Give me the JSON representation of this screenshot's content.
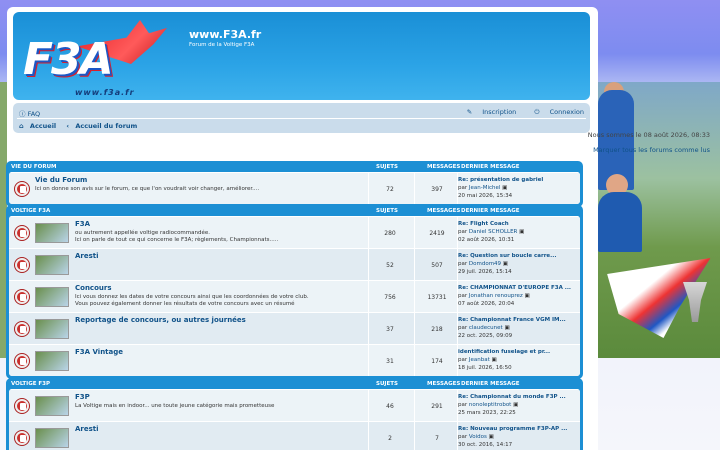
{
  "header": {
    "site_title": "www.F3A.fr",
    "site_desc": "Forum de la Voltige F3A",
    "logo_text": "F3A",
    "logo_url": "www.f3a.fr"
  },
  "nav": {
    "faq": "FAQ",
    "register": "Inscription",
    "login": "Connexion",
    "home": "Accueil",
    "forum_index": "Accueil du forum",
    "sep": "‹"
  },
  "info": {
    "date": "Nous sommes le 08 août 2026, 08:33",
    "mark_read": "Marquer tous les forums comme lus"
  },
  "columns": {
    "topics": "SUJETS",
    "posts": "MESSAGES",
    "last_post": "DERNIER MESSAGE"
  },
  "categories": [
    {
      "title": "VIE DU FORUM",
      "forums": [
        {
          "name": "Vie du Forum",
          "desc": "Ici on donne son avis sur le forum, ce que l'on voudrait voir changer, améliorer....",
          "topics": "72",
          "posts": "397",
          "last_title": "Re: présentation de gabriel",
          "last_by": "Jean-Michel",
          "last_date": "20 mai 2026, 15:34"
        }
      ]
    },
    {
      "title": "VOLTIGE F3A",
      "forums": [
        {
          "name": "F3A",
          "desc": "ou autrement appellée voltige radiocommandée.\nIci on parle de tout ce qui concerne le F3A; règlements, Championnats.....",
          "topics": "280",
          "posts": "2419",
          "last_title": "Re: Flight Coach",
          "last_by": "Daniel SCHOLLER",
          "last_date": "02 août 2026, 10:31"
        },
        {
          "name": "Aresti",
          "desc": "",
          "topics": "52",
          "posts": "507",
          "last_title": "Re: Question sur boucle carre...",
          "last_by": "Domdom49",
          "last_date": "29 juil. 2026, 15:14"
        },
        {
          "name": "Concours",
          "desc": "Ici vous donnez les dates de votre concours ainsi que les coordonnées de votre club.\nVous pouvez également donner les résultats de votre concours avec un résumé",
          "topics": "756",
          "posts": "13731",
          "last_title": "Re: CHAMPIONNAT D'EUROPE F3A ...",
          "last_by": "Jonathan renouprez",
          "last_date": "07 août 2026, 20:04"
        },
        {
          "name": "Reportage de concours, ou autres journées",
          "desc": "",
          "topics": "37",
          "posts": "218",
          "last_title": "Re: Championnat France VGM IM...",
          "last_by": "claudecunet",
          "last_date": "22 oct. 2025, 09:09"
        },
        {
          "name": "F3A Vintage",
          "desc": "",
          "topics": "31",
          "posts": "174",
          "last_title": "identification fuselage et pr...",
          "last_by": "Jeanbat",
          "last_date": "18 juil. 2026, 16:50"
        }
      ]
    },
    {
      "title": "VOLTIGE F3P",
      "forums": [
        {
          "name": "F3P",
          "desc": "La Voltige mais en indoor... une toute jeune catégorie mais prometteuse",
          "topics": "46",
          "posts": "291",
          "last_title": "Re: Championnat du monde F3P ...",
          "last_by": "nonoleptitrobot",
          "last_date": "25 mars 2023, 22:25"
        },
        {
          "name": "Aresti",
          "desc": "",
          "topics": "2",
          "posts": "7",
          "last_title": "Re: Nouveau programme F3P-AP ...",
          "last_by": "Voidos",
          "last_date": "30 oct. 2016, 14:17"
        }
      ]
    }
  ],
  "last_prefix": "par",
  "colors": {
    "header_blue": "#1a8fd6",
    "link": "#105289",
    "row_a": "#ecf3f7",
    "row_b": "#e1ebf2"
  }
}
